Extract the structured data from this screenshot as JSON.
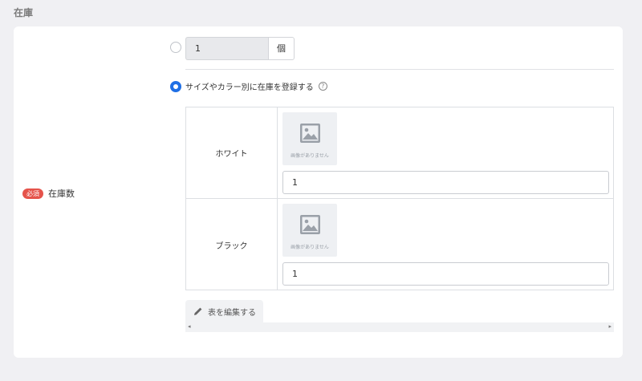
{
  "section": {
    "title": "在庫"
  },
  "field": {
    "required_badge": "必須",
    "label": "在庫数"
  },
  "simple": {
    "quantity": "1",
    "unit": "個"
  },
  "by_variant": {
    "label": "サイズやカラー別に在庫を登録する",
    "help_icon_text": "?"
  },
  "variants": [
    {
      "name": "ホワイト",
      "image_caption": "画像がありません",
      "stock": "1"
    },
    {
      "name": "ブラック",
      "image_caption": "画像がありません",
      "stock": "1"
    }
  ],
  "table_actions": {
    "edit_label": "表を編集する"
  },
  "scrollbar": {
    "left_arrow": "◂",
    "right_arrow": "▸"
  },
  "colors": {
    "accent": "#1f6fe5",
    "required": "#e5534b",
    "background": "#f0f0f3"
  }
}
